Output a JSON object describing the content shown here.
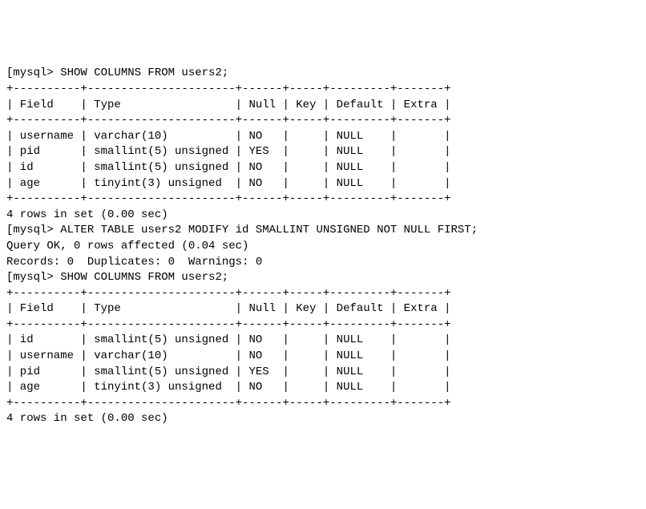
{
  "session": {
    "prompt": "mysql>",
    "bracket_prefix": "[mysql>"
  },
  "blocks": [
    {
      "cmd": "SHOW COLUMNS FROM users2;",
      "table": {
        "header": [
          "Field",
          "Type",
          "Null",
          "Key",
          "Default",
          "Extra"
        ],
        "rows": [
          [
            "username",
            "varchar(10)",
            "NO",
            "",
            "NULL",
            ""
          ],
          [
            "pid",
            "smallint(5) unsigned",
            "YES",
            "",
            "NULL",
            ""
          ],
          [
            "id",
            "smallint(5) unsigned",
            "NO",
            "",
            "NULL",
            ""
          ],
          [
            "age",
            "tinyint(3) unsigned",
            "NO",
            "",
            "NULL",
            ""
          ]
        ],
        "widths": [
          10,
          22,
          6,
          5,
          9,
          7
        ]
      },
      "footer": "4 rows in set (0.00 sec)"
    },
    {
      "cmd": "ALTER TABLE users2 MODIFY id SMALLINT UNSIGNED NOT NULL FIRST;",
      "result_lines": [
        "Query OK, 0 rows affected (0.04 sec)",
        "Records: 0  Duplicates: 0  Warnings: 0"
      ]
    },
    {
      "cmd": "SHOW COLUMNS FROM users2;",
      "table": {
        "header": [
          "Field",
          "Type",
          "Null",
          "Key",
          "Default",
          "Extra"
        ],
        "rows": [
          [
            "id",
            "smallint(5) unsigned",
            "NO",
            "",
            "NULL",
            ""
          ],
          [
            "username",
            "varchar(10)",
            "NO",
            "",
            "NULL",
            ""
          ],
          [
            "pid",
            "smallint(5) unsigned",
            "YES",
            "",
            "NULL",
            ""
          ],
          [
            "age",
            "tinyint(3) unsigned",
            "NO",
            "",
            "NULL",
            ""
          ]
        ],
        "widths": [
          10,
          22,
          6,
          5,
          9,
          7
        ]
      },
      "footer": "4 rows in set (0.00 sec)",
      "truncated_footer": true
    }
  ]
}
